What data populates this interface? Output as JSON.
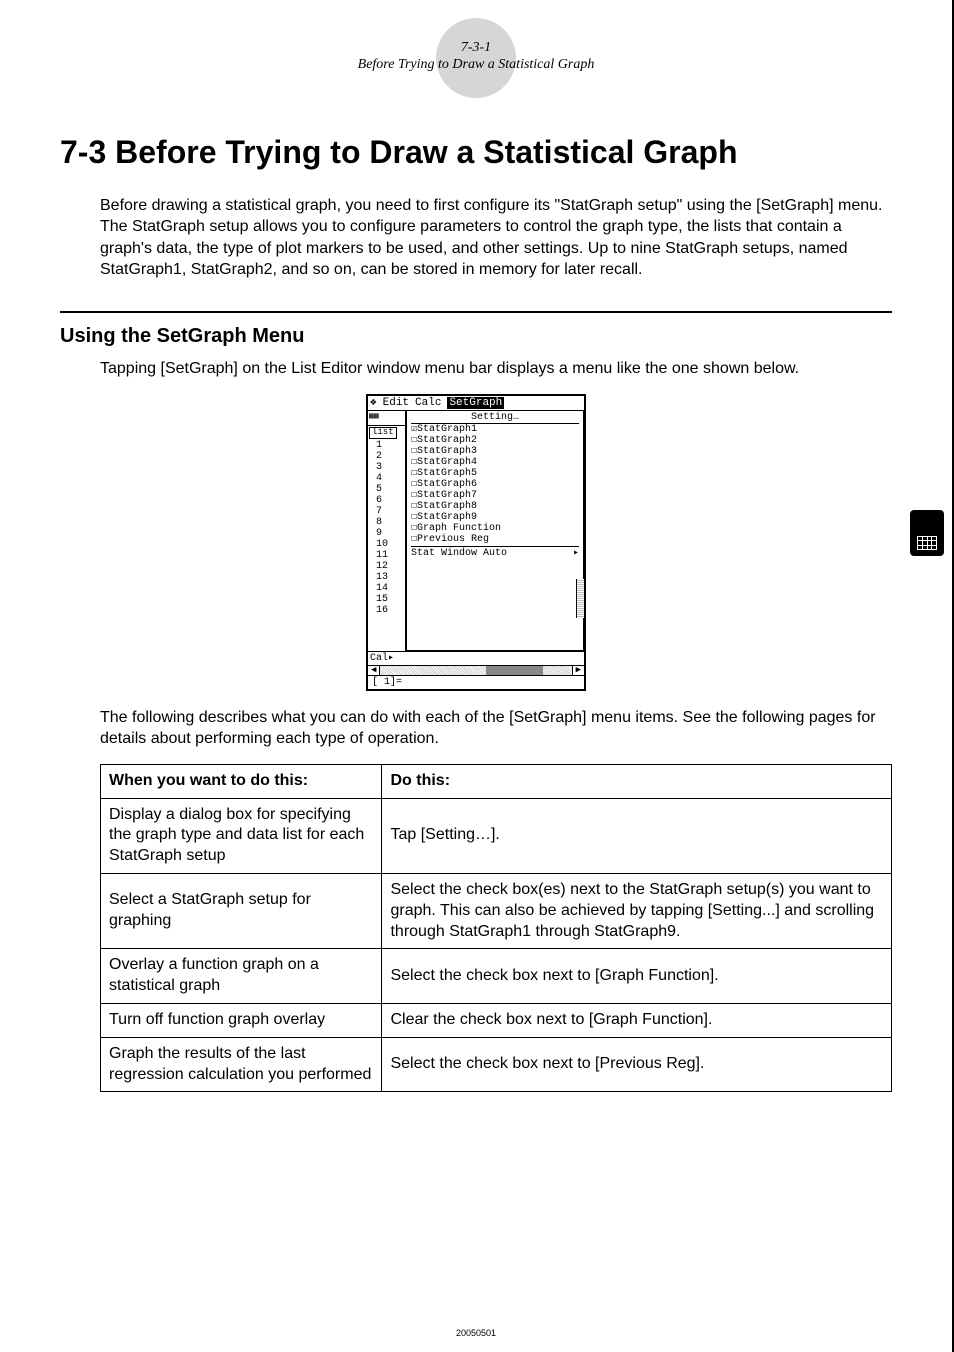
{
  "header": {
    "section_number": "7-3-1",
    "section_subtitle": "Before Trying to Draw a Statistical Graph"
  },
  "title": "7-3  Before Trying to Draw a Statistical Graph",
  "intro": "Before drawing a statistical graph, you need to first configure its \"StatGraph setup\" using the [SetGraph] menu.\nThe StatGraph setup allows you to configure parameters to control the graph type, the lists that contain a graph's data, the type of plot markers to be used, and other settings. Up to nine StatGraph setups, named StatGraph1, StatGraph2, and so on, can be stored in memory for later recall.",
  "subtitle": "Using the SetGraph Menu",
  "para1": "Tapping [SetGraph] on the List Editor window menu bar displays a menu like the one shown below.",
  "calc": {
    "menubar": {
      "edit": "Edit",
      "calc": "Calc",
      "setgraph": "SetGraph"
    },
    "dropdown": {
      "setting": "Setting…",
      "items": [
        "☑StatGraph1",
        "☐StatGraph2",
        "☐StatGraph3",
        "☐StatGraph4",
        "☐StatGraph5",
        "☐StatGraph6",
        "☐StatGraph7",
        "☐StatGraph8",
        "☐StatGraph9",
        "☐Graph Function",
        "☐Previous Reg"
      ],
      "stat_window": "Stat Window Auto",
      "arrow": "▸"
    },
    "left": {
      "list_label": "list",
      "rows": "1\n2\n3\n4\n5\n6\n7\n8\n9\n10\n11\n12\n13\n14\n15\n16"
    },
    "bottom": "Cal▸",
    "status": "[    1]="
  },
  "para2": "The following describes what you can do with each of the [SetGraph] menu items. See the following pages for details about performing each type of operation.",
  "table": {
    "head": {
      "c1": "When you want to do this:",
      "c2": "Do this:"
    },
    "rows": [
      {
        "c1": "Display a dialog box for specifying the graph type and data list for each StatGraph setup",
        "c2": "Tap [Setting…]."
      },
      {
        "c1": "Select a StatGraph setup for graphing",
        "c2": "Select the check box(es) next to the StatGraph setup(s) you want to graph. This can also be achieved by tapping [Setting...] and scrolling through StatGraph1 through StatGraph9."
      },
      {
        "c1": "Overlay a function graph on a statistical graph",
        "c2": "Select the check box next to [Graph Function]."
      },
      {
        "c1": "Turn off function graph overlay",
        "c2": "Clear the check box next to [Graph Function]."
      },
      {
        "c1": "Graph the results of the last regression calculation you performed",
        "c2": "Select the check box next to [Previous Reg]."
      }
    ]
  },
  "footer": "20050501"
}
